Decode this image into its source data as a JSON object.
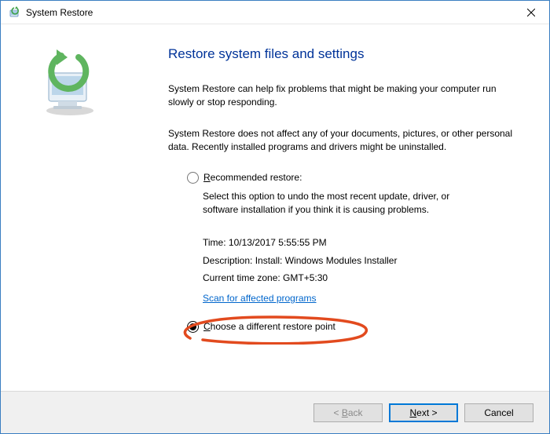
{
  "window": {
    "title": "System Restore"
  },
  "heading": "Restore system files and settings",
  "intro1": "System Restore can help fix problems that might be making your computer run slowly or stop responding.",
  "intro2": "System Restore does not affect any of your documents, pictures, or other personal data. Recently installed programs and drivers might be uninstalled.",
  "options": {
    "recommended": {
      "label_pre": "R",
      "label_rest": "ecommended restore:",
      "desc": "Select this option to undo the most recent update, driver, or software installation if you think it is causing problems."
    },
    "choose": {
      "label_pre": "C",
      "label_rest": "hoose a different restore point"
    }
  },
  "details": {
    "time_label": "Time: ",
    "time_value": "10/13/2017 5:55:55 PM",
    "desc_label": "Description: ",
    "desc_value": "Install: Windows Modules Installer",
    "tz_label": "Current time zone: ",
    "tz_value": "GMT+5:30"
  },
  "scan_link": "Scan for affected programs",
  "buttons": {
    "back": "< Back",
    "next_pre": "N",
    "next_rest": "ext >",
    "cancel": "Cancel"
  },
  "colors": {
    "heading": "#003399",
    "link": "#0066cc",
    "highlight": "#e24a1e"
  }
}
